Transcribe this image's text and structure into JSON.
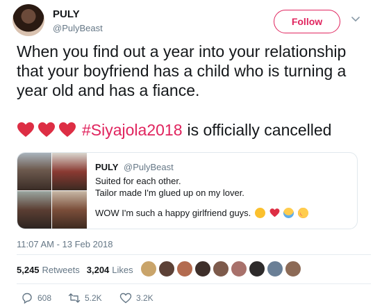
{
  "user": {
    "name": "PULY",
    "handle": "@PulyBeast",
    "follow_label": "Follow"
  },
  "tweet": {
    "text": "When you find out a year into your relationship that your boyfriend has a child who is turning a year old and has a fiance.",
    "hashtag": "#Siyajola2018",
    "rest": "is officially cancelled",
    "hearts": [
      "heart-icon",
      "heart-icon",
      "heart-icon"
    ]
  },
  "quote": {
    "name": "PULY",
    "handle": "@PulyBeast",
    "lines": [
      "Suited for each other.",
      "Tailor made I'm glued up on my lover."
    ],
    "last_line": "WOW I'm such a happy girlfriend guys.",
    "emojis": [
      "tears-of-joy-emoji",
      "red-heart-emoji",
      "crying-face-emoji",
      "heart-eyes-emoji"
    ]
  },
  "timestamp": "11:07 AM - 13 Feb 2018",
  "stats": {
    "retweets_count": "5,245",
    "retweets_label": "Retweets",
    "likes_count": "3,204",
    "likes_label": "Likes"
  },
  "actions": {
    "replies": "608",
    "retweets": "5.2K",
    "likes": "3.2K"
  },
  "colors": {
    "accent": "#e0245e",
    "text": "#14171a",
    "muted": "#657786",
    "border": "#e1e8ed"
  }
}
